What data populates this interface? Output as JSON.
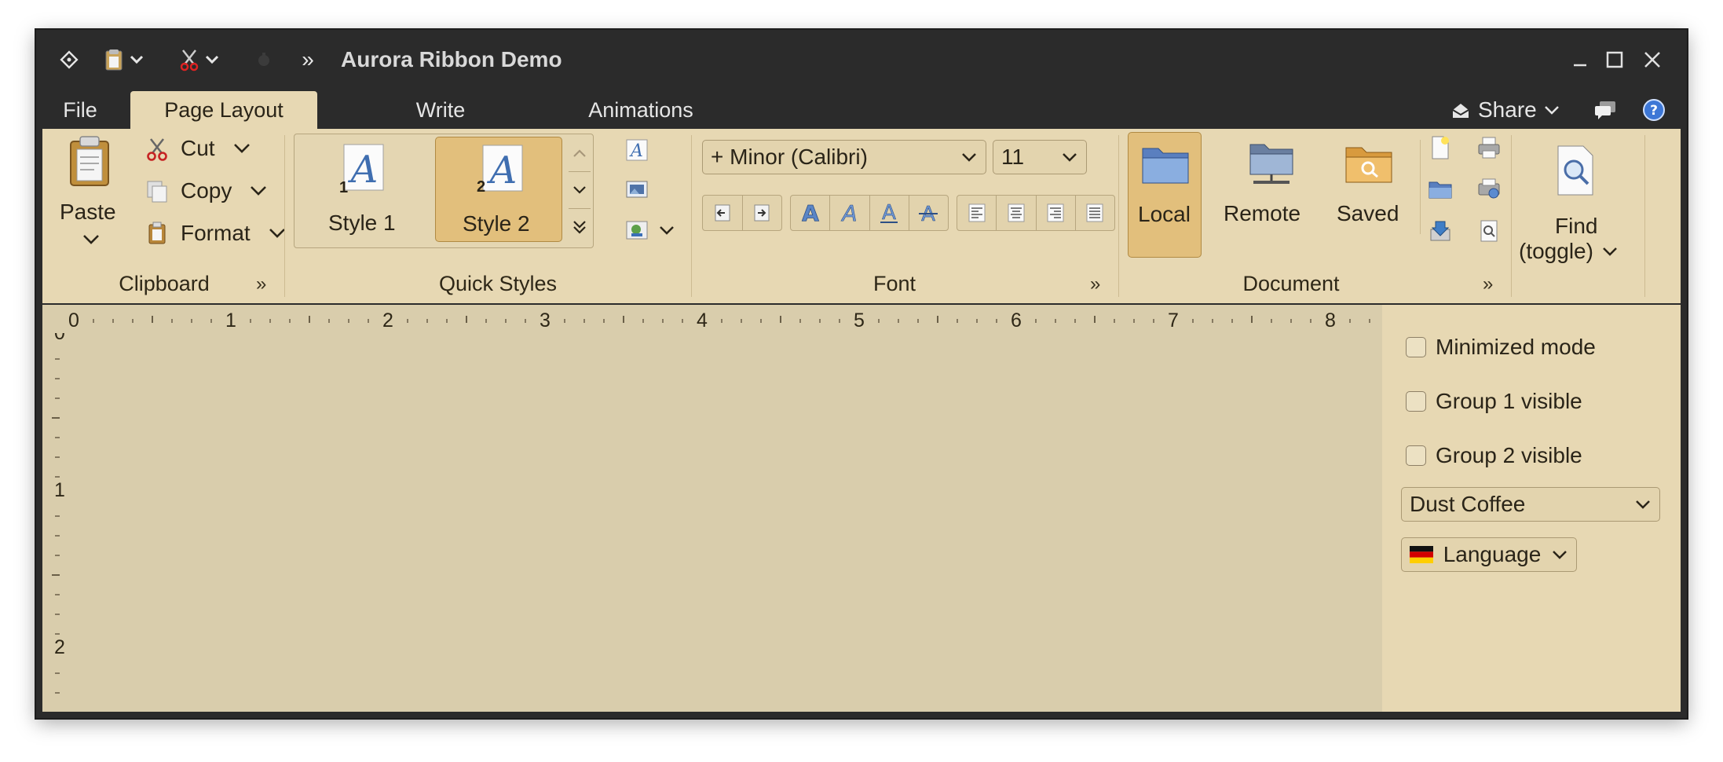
{
  "window": {
    "title": "Aurora Ribbon Demo",
    "overflow_label": "»"
  },
  "tabs": [
    {
      "label": "File"
    },
    {
      "label": "Page Layout",
      "active": true
    },
    {
      "label": "Write"
    },
    {
      "label": "Animations"
    }
  ],
  "taskbar": {
    "share_label": "Share"
  },
  "clipboard": {
    "title": "Clipboard",
    "paste_label": "Paste",
    "cut_label": "Cut",
    "copy_label": "Copy",
    "format_label": "Format"
  },
  "quick_styles": {
    "title": "Quick Styles",
    "styles": [
      {
        "label": "Style 1",
        "number": "1",
        "selected": false
      },
      {
        "label": "Style 2",
        "number": "2",
        "selected": true
      }
    ]
  },
  "font": {
    "title": "Font",
    "family": "+ Minor (Calibri)",
    "size": "11"
  },
  "document": {
    "title": "Document",
    "local_label": "Local",
    "remote_label": "Remote",
    "saved_label": "Saved"
  },
  "find": {
    "label_line1": "Find",
    "label_line2": "(toggle)"
  },
  "ruler": {
    "top_labels": [
      "0",
      "1",
      "2",
      "3",
      "4",
      "5",
      "6",
      "7",
      "8"
    ],
    "left_labels": [
      "0",
      "1",
      "2"
    ]
  },
  "side_panel": {
    "checkboxes": [
      {
        "label": "Minimized mode",
        "checked": false
      },
      {
        "label": "Group 1 visible",
        "checked": false
      },
      {
        "label": "Group 2 visible",
        "checked": false
      }
    ],
    "skin_select": "Dust Coffee",
    "language_label": "Language"
  },
  "colors": {
    "ribbon_bg": "#e7d8b3",
    "title_bg": "#2b2b2b",
    "content_bg": "#d9cdac",
    "selected_bg": "#e2bf7c"
  }
}
